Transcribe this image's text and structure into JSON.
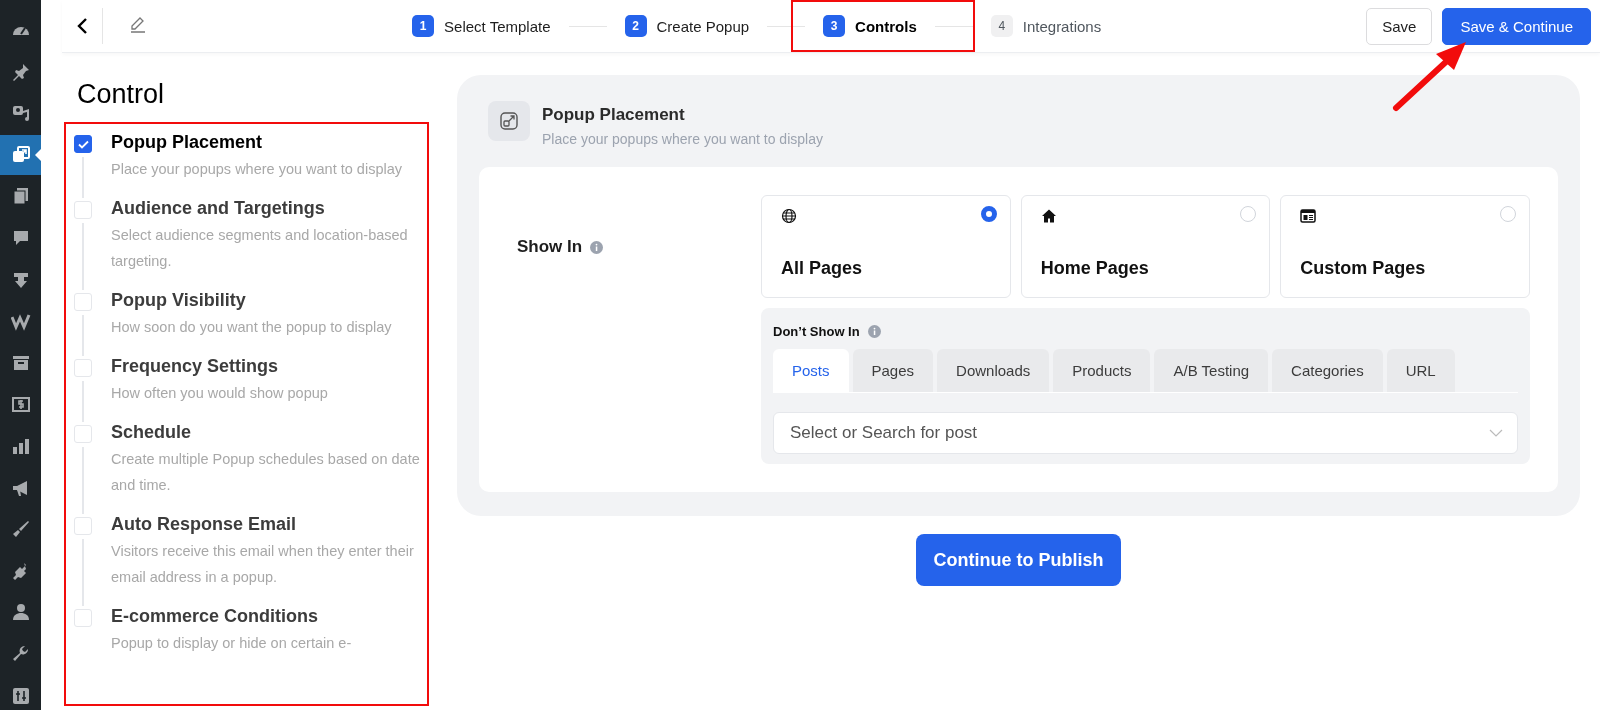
{
  "admin_menu": [
    {
      "kind": "gauge",
      "selected": false
    },
    {
      "kind": "pin",
      "selected": false
    },
    {
      "kind": "media",
      "selected": false
    },
    {
      "kind": "popup",
      "selected": true
    },
    {
      "kind": "pages",
      "selected": false
    },
    {
      "kind": "comment",
      "selected": false
    },
    {
      "kind": "download",
      "selected": false
    },
    {
      "kind": "zigzag",
      "selected": false
    },
    {
      "kind": "archive",
      "selected": false
    },
    {
      "kind": "banknote",
      "selected": false
    },
    {
      "kind": "chart",
      "selected": false
    },
    {
      "kind": "megaphone",
      "selected": false
    },
    {
      "kind": "brush",
      "selected": false
    },
    {
      "kind": "plug",
      "selected": false
    },
    {
      "kind": "user",
      "selected": false
    },
    {
      "kind": "wrench",
      "selected": false
    },
    {
      "kind": "sliders",
      "selected": false
    }
  ],
  "top_bar": {
    "steps": [
      {
        "number": "1",
        "label": "Select Template",
        "reached": true,
        "selected": false,
        "highlighted": false
      },
      {
        "number": "2",
        "label": "Create Popup",
        "reached": true,
        "selected": false,
        "highlighted": false
      },
      {
        "number": "3",
        "label": "Controls",
        "reached": true,
        "selected": true,
        "highlighted": true
      },
      {
        "number": "4",
        "label": "Integrations",
        "reached": false,
        "selected": false,
        "highlighted": false
      }
    ],
    "save_button": "Save",
    "save_continue_button": {
      "label": "Save & Continue",
      "pointed_by_arrow": true
    }
  },
  "control": {
    "title": "Control",
    "highlighted": true,
    "items": [
      {
        "title": "Popup Placement",
        "description": "Place your popups where you want to display",
        "checked": true
      },
      {
        "title": "Audience and Targetings",
        "description": "Select audience segments and location-based targeting.",
        "checked": false
      },
      {
        "title": "Popup Visibility",
        "description": "How soon do you want the popup to display",
        "checked": false
      },
      {
        "title": "Frequency Settings",
        "description": "How often you would show popup",
        "checked": false
      },
      {
        "title": "Schedule",
        "description": "Create multiple Popup schedules based on date and time.",
        "checked": false
      },
      {
        "title": "Auto Response Email",
        "description": "Visitors receive this email when they enter their email address in a popup.",
        "checked": false
      },
      {
        "title": "E-commerce Conditions",
        "description": "Popup to display or hide on certain e-",
        "checked": false
      }
    ]
  },
  "placement": {
    "title": "Popup Placement",
    "subtitle": "Place your popups where you want to display",
    "show_in": {
      "label": "Show In",
      "options": [
        {
          "label": "All Pages",
          "kind": "globe",
          "selected": true
        },
        {
          "label": "Home Pages",
          "kind": "home",
          "selected": false
        },
        {
          "label": "Custom Pages",
          "kind": "browser",
          "selected": false
        }
      ]
    },
    "dont_show_in": {
      "label": "Don’t Show In",
      "tabs": [
        {
          "label": "Posts",
          "selected": true
        },
        {
          "label": "Pages",
          "selected": false
        },
        {
          "label": "Downloads",
          "selected": false
        },
        {
          "label": "Products",
          "selected": false
        },
        {
          "label": "A/B Testing",
          "selected": false
        },
        {
          "label": "Categories",
          "selected": false
        },
        {
          "label": "URL",
          "selected": false
        }
      ],
      "select": {
        "placeholder": "Select or Search for post"
      }
    }
  },
  "continue_button": "Continue to Publish"
}
